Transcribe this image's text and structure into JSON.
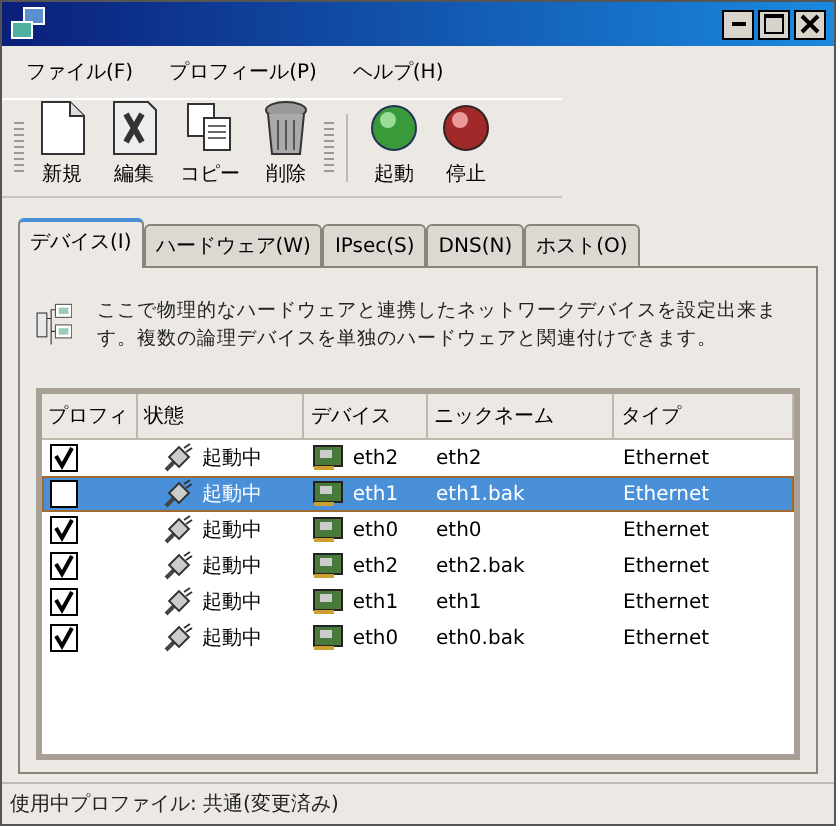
{
  "menu": [
    "ファイル(F)",
    "プロフィール(P)",
    "ヘルプ(H)"
  ],
  "toolbar": [
    {
      "label": "新規",
      "kind": "new"
    },
    {
      "label": "編集",
      "kind": "edit"
    },
    {
      "label": "コピー",
      "kind": "copy"
    },
    {
      "label": "削除",
      "kind": "delete"
    },
    {
      "label": "起動",
      "kind": "start"
    },
    {
      "label": "停止",
      "kind": "stop"
    }
  ],
  "tabs": [
    {
      "label": "デバイス(I)",
      "selected": true
    },
    {
      "label": "ハードウェア(W)",
      "selected": false
    },
    {
      "label": "IPsec(S)",
      "selected": false
    },
    {
      "label": "DNS(N)",
      "selected": false
    },
    {
      "label": "ホスト(O)",
      "selected": false
    }
  ],
  "description": "ここで物理的なハードウェアと連携したネットワークデバイスを設定出来ます。複数の論理デバイスを単独のハードウェアと関連付けできます。",
  "table": {
    "columns": [
      "プロフィ",
      "状態",
      "デバイス",
      "ニックネーム",
      "タイプ"
    ],
    "rows": [
      {
        "checked": true,
        "selected": false,
        "status": "起動中",
        "device": "eth2",
        "nickname": "eth2",
        "type": "Ethernet"
      },
      {
        "checked": false,
        "selected": true,
        "status": "起動中",
        "device": "eth1",
        "nickname": "eth1.bak",
        "type": "Ethernet"
      },
      {
        "checked": true,
        "selected": false,
        "status": "起動中",
        "device": "eth0",
        "nickname": "eth0",
        "type": "Ethernet"
      },
      {
        "checked": true,
        "selected": false,
        "status": "起動中",
        "device": "eth2",
        "nickname": "eth2.bak",
        "type": "Ethernet"
      },
      {
        "checked": true,
        "selected": false,
        "status": "起動中",
        "device": "eth1",
        "nickname": "eth1",
        "type": "Ethernet"
      },
      {
        "checked": true,
        "selected": false,
        "status": "起動中",
        "device": "eth0",
        "nickname": "eth0.bak",
        "type": "Ethernet"
      }
    ]
  },
  "status_bar": "使用中プロファイル: 共通(変更済み)"
}
